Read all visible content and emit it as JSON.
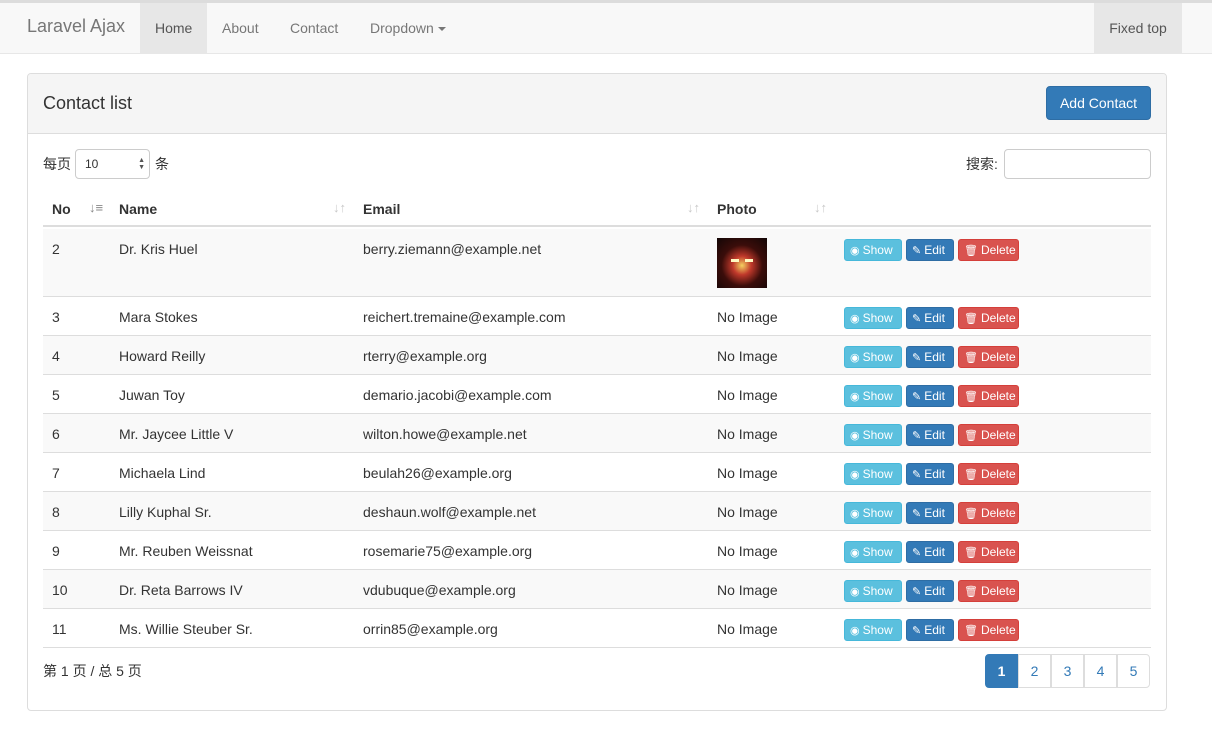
{
  "navbar": {
    "brand": "Laravel Ajax",
    "items": [
      {
        "label": "Home",
        "active": true
      },
      {
        "label": "About",
        "active": false
      },
      {
        "label": "Contact",
        "active": false
      },
      {
        "label": "Dropdown",
        "active": false
      }
    ],
    "right_item": "Fixed top"
  },
  "panel": {
    "title": "Contact list",
    "add_button": "Add Contact"
  },
  "length": {
    "prefix": "每页",
    "value": "10",
    "suffix": "条"
  },
  "search": {
    "label": "搜索:",
    "value": ""
  },
  "table": {
    "headers": [
      "No",
      "Name",
      "Email",
      "Photo"
    ],
    "sorted_column": "No",
    "rows": [
      {
        "no": "2",
        "name": "Dr. Kris Huel",
        "email": "berry.ziemann@example.net",
        "photo": "",
        "has_image": true
      },
      {
        "no": "3",
        "name": "Mara Stokes",
        "email": "reichert.tremaine@example.com",
        "photo": "No Image",
        "has_image": false
      },
      {
        "no": "4",
        "name": "Howard Reilly",
        "email": "rterry@example.org",
        "photo": "No Image",
        "has_image": false
      },
      {
        "no": "5",
        "name": "Juwan Toy",
        "email": "demario.jacobi@example.com",
        "photo": "No Image",
        "has_image": false
      },
      {
        "no": "6",
        "name": "Mr. Jaycee Little V",
        "email": "wilton.howe@example.net",
        "photo": "No Image",
        "has_image": false
      },
      {
        "no": "7",
        "name": "Michaela Lind",
        "email": "beulah26@example.org",
        "photo": "No Image",
        "has_image": false
      },
      {
        "no": "8",
        "name": "Lilly Kuphal Sr.",
        "email": "deshaun.wolf@example.net",
        "photo": "No Image",
        "has_image": false
      },
      {
        "no": "9",
        "name": "Mr. Reuben Weissnat",
        "email": "rosemarie75@example.org",
        "photo": "No Image",
        "has_image": false
      },
      {
        "no": "10",
        "name": "Dr. Reta Barrows IV",
        "email": "vdubuque@example.org",
        "photo": "No Image",
        "has_image": false
      },
      {
        "no": "11",
        "name": "Ms. Willie Steuber Sr.",
        "email": "orrin85@example.org",
        "photo": "No Image",
        "has_image": false
      }
    ],
    "actions": {
      "show": "Show",
      "edit": "Edit",
      "delete": "Delete"
    }
  },
  "footer": {
    "info": "第 1 页 / 总 5 页",
    "pages": [
      "1",
      "2",
      "3",
      "4",
      "5"
    ],
    "active_page": "1"
  },
  "colors": {
    "primary": "#337ab7",
    "info": "#5bc0de",
    "danger": "#d9534f"
  },
  "icons": {
    "sort_asc": "sort-amount-asc-icon",
    "sort_both": "sort-both-icon",
    "show": "eye-icon",
    "edit": "edit-square-icon",
    "delete": "trash-icon"
  }
}
